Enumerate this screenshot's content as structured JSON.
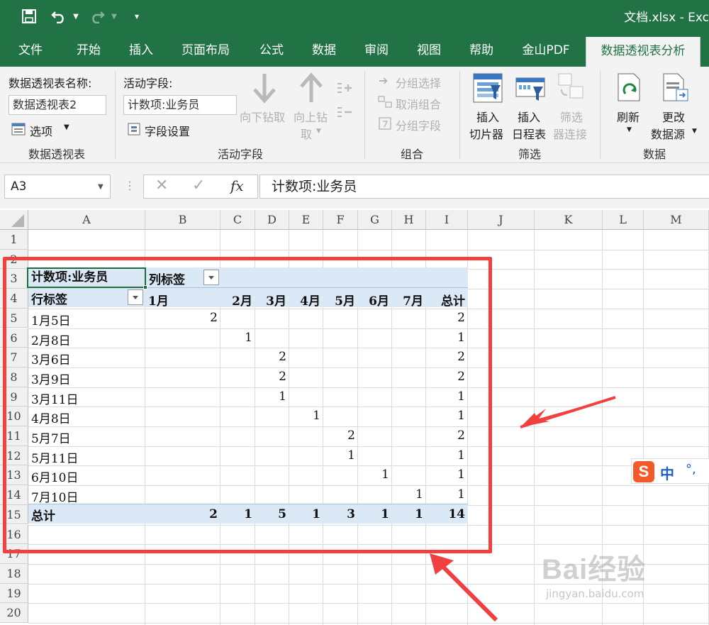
{
  "title_bar": {
    "doc_title": "文档.xlsx  -  Exc"
  },
  "tabs": [
    "文件",
    "开始",
    "插入",
    "页面布局",
    "公式",
    "数据",
    "审阅",
    "视图",
    "帮助",
    "金山PDF",
    "数据透视表分析"
  ],
  "ribbon": {
    "pivot_name_label": "数据透视表名称:",
    "pivot_name_value": "数据透视表2",
    "options_label": "选项",
    "group1": "数据透视表",
    "active_field_label": "活动字段:",
    "active_field_value": "计数项:业务员",
    "field_settings": "字段设置",
    "drill_down": "向下钻取",
    "drill_up_1": "向上钻",
    "drill_up_2": "取",
    "group2": "活动字段",
    "group_selection": "分组选择",
    "ungroup": "取消组合",
    "group_field": "分组字段",
    "group3": "组合",
    "slicer_1": "插入",
    "slicer_2": "切片器",
    "timeline_1": "插入",
    "timeline_2": "日程表",
    "filter_conn_1": "筛选",
    "filter_conn_2": "器连接",
    "group4": "筛选",
    "refresh": "刷新",
    "change_source_1": "更改",
    "change_source_2": "数据源",
    "group5": "数据"
  },
  "formula_bar": {
    "name_box": "A3",
    "fx": "fx",
    "formula": "计数项:业务员"
  },
  "columns": [
    "A",
    "B",
    "C",
    "D",
    "E",
    "F",
    "G",
    "H",
    "I",
    "J",
    "K",
    "L",
    "M"
  ],
  "rows": [
    "1",
    "2",
    "3",
    "4",
    "5",
    "6",
    "7",
    "8",
    "9",
    "10",
    "11",
    "12",
    "13",
    "14",
    "15",
    "16",
    "17",
    "18",
    "19",
    "20"
  ],
  "pivot": {
    "header_label": "计数项:业务员",
    "col_label": "列标签",
    "row_label": "行标签",
    "months": [
      "1月",
      "2月",
      "3月",
      "4月",
      "5月",
      "6月",
      "7月",
      "总计"
    ],
    "row_items": [
      {
        "label": "1月5日",
        "col": 0,
        "value": "2",
        "total": "2"
      },
      {
        "label": "2月8日",
        "col": 1,
        "value": "1",
        "total": "1"
      },
      {
        "label": "3月6日",
        "col": 2,
        "value": "2",
        "total": "2"
      },
      {
        "label": "3月9日",
        "col": 2,
        "value": "2",
        "total": "2"
      },
      {
        "label": "3月11日",
        "col": 2,
        "value": "1",
        "total": "1"
      },
      {
        "label": "4月8日",
        "col": 3,
        "value": "1",
        "total": "1"
      },
      {
        "label": "5月7日",
        "col": 4,
        "value": "2",
        "total": "2"
      },
      {
        "label": "5月11日",
        "col": 4,
        "value": "1",
        "total": "1"
      },
      {
        "label": "6月10日",
        "col": 5,
        "value": "1",
        "total": "1"
      },
      {
        "label": "7月10日",
        "col": 6,
        "value": "1",
        "total": "1"
      }
    ],
    "grand_total_label": "总计",
    "grand_totals": [
      "2",
      "1",
      "5",
      "1",
      "3",
      "1",
      "1",
      "14"
    ]
  },
  "ime": {
    "label": "中",
    "extra": "°,"
  },
  "watermark": {
    "line1": "Bai经验",
    "line2": "jingyan.baidu.com"
  },
  "colors": {
    "excel_green": "#217346",
    "highlight_red": "#f04040",
    "pivot_band": "#dbe8f5"
  }
}
